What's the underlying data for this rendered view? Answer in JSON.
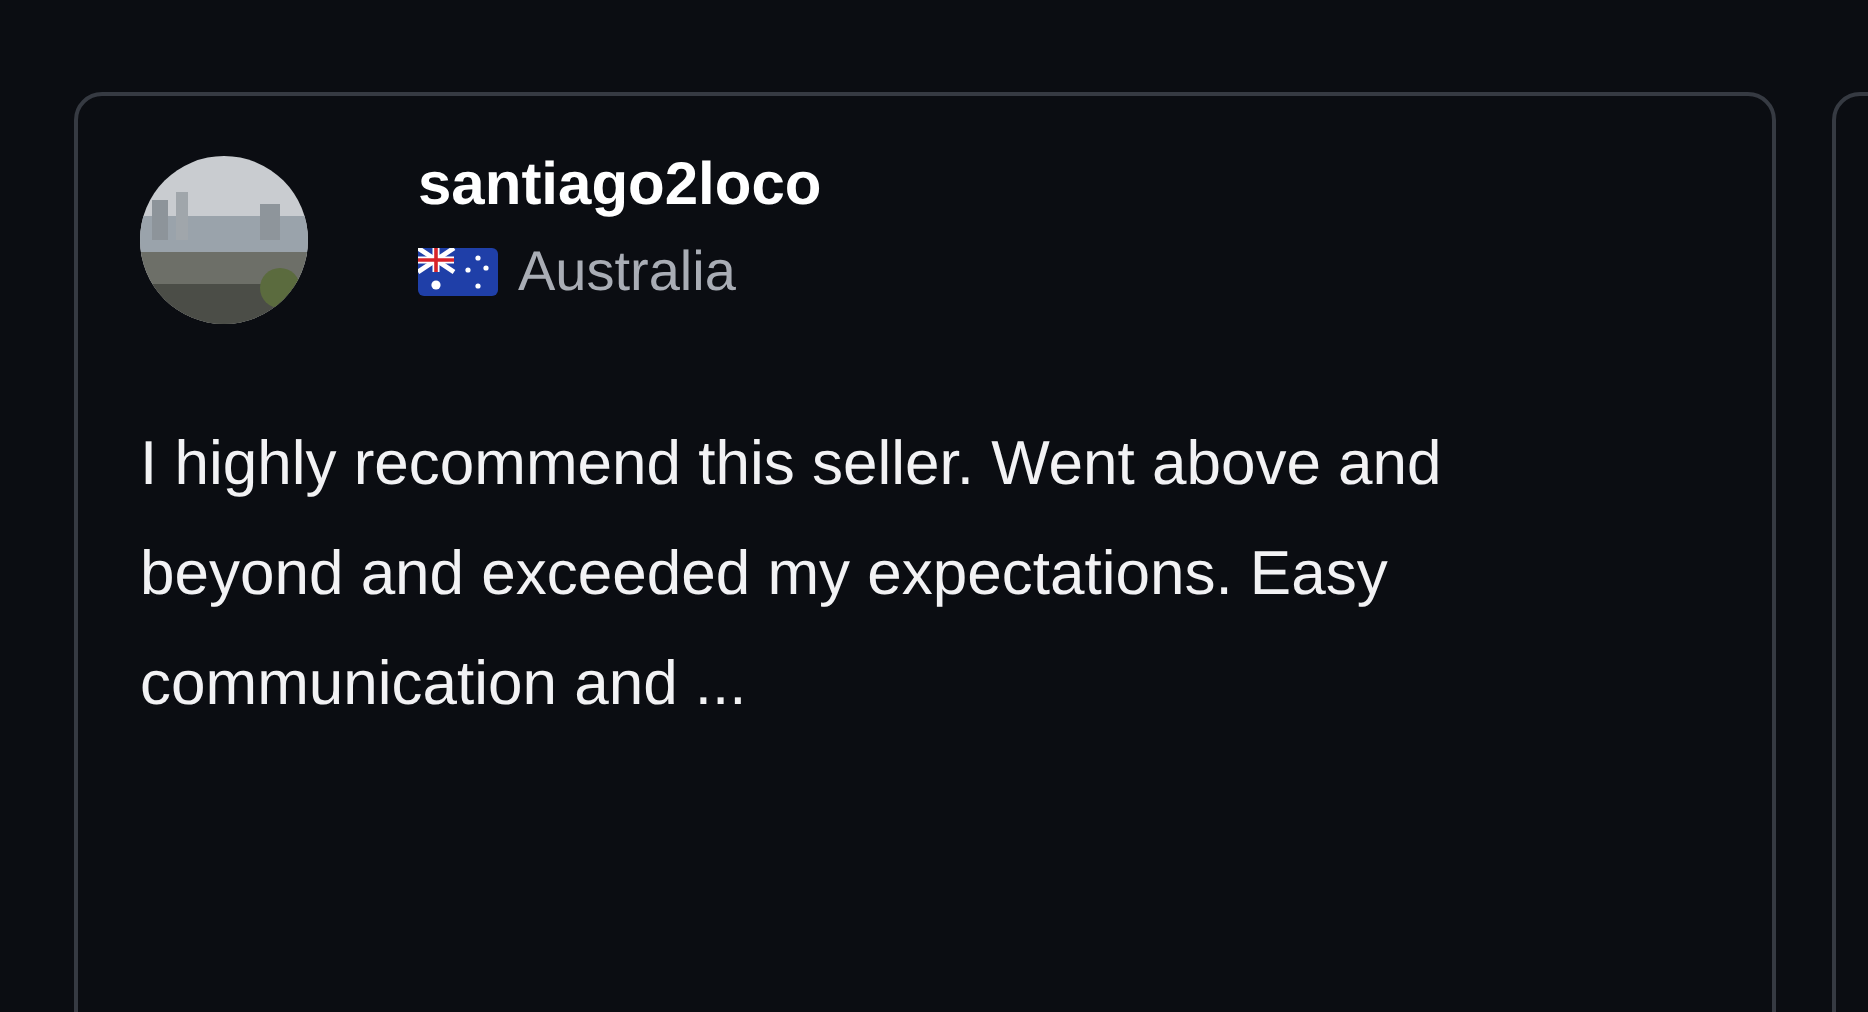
{
  "review": {
    "username": "santiago2loco",
    "country": "Australia",
    "text": "I highly recommend this seller. Went above and beyond and exceeded my expectations. Easy communication and ..."
  }
}
